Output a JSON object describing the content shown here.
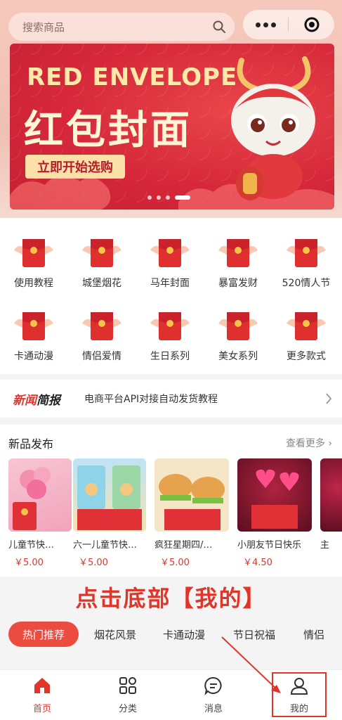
{
  "search": {
    "placeholder": "搜索商品"
  },
  "banner": {
    "title_en": "RED ENVELOPE",
    "title_cn": "红包封面",
    "button": "立即开始选购",
    "slide_count": 4,
    "active_slide": 4
  },
  "categories": [
    {
      "label": "使用教程"
    },
    {
      "label": "城堡烟花"
    },
    {
      "label": "马年封面"
    },
    {
      "label": "暴富发财"
    },
    {
      "label": "520情人节"
    },
    {
      "label": "卡通动漫"
    },
    {
      "label": "情侣爱情"
    },
    {
      "label": "生日系列"
    },
    {
      "label": "美女系列"
    },
    {
      "label": "更多款式"
    }
  ],
  "news": {
    "logo_a": "新闻",
    "logo_b": "简报",
    "text": "电商平台API对接自动发货教程"
  },
  "new_products": {
    "title": "新品发布",
    "more": "查看更多",
    "items": [
      {
        "name": "儿童节快…",
        "price": "￥5.00"
      },
      {
        "name": "六一儿童节快…",
        "price": "￥5.00"
      },
      {
        "name": "疯狂星期四/…",
        "price": "￥5.00"
      },
      {
        "name": "小朋友节日快乐",
        "price": "￥4.50"
      },
      {
        "name": "主",
        "price": ""
      }
    ]
  },
  "annotation": "点击底部【我的】",
  "tabs": [
    "热门推荐",
    "烟花风景",
    "卡通动漫",
    "节日祝福",
    "情侣"
  ],
  "bottom_nav": [
    {
      "label": "首页",
      "icon": "home-icon"
    },
    {
      "label": "分类",
      "icon": "grid-icon"
    },
    {
      "label": "消息",
      "icon": "chat-icon"
    },
    {
      "label": "我的",
      "icon": "user-icon"
    }
  ],
  "colors": {
    "accent": "#e0362a",
    "tab_active": "#ec4c3f",
    "banner_red": "#d6283a"
  }
}
